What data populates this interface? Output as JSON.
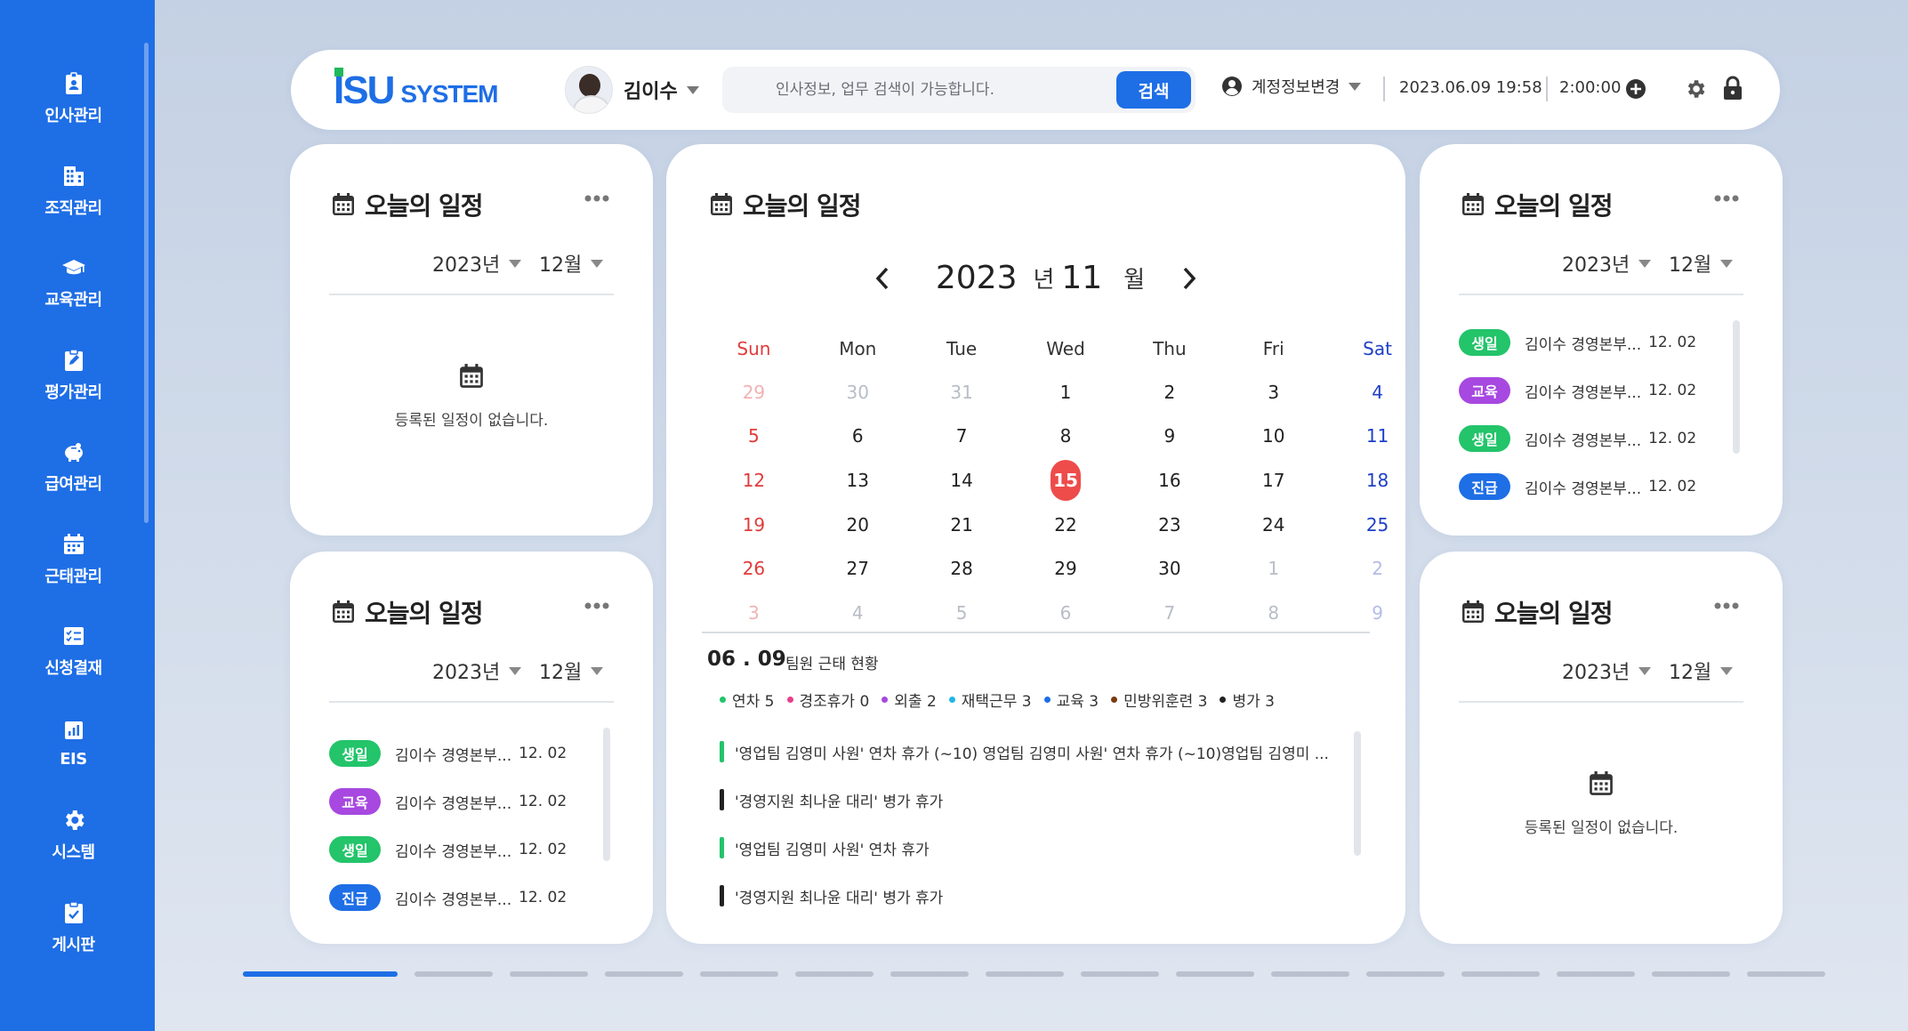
{
  "colors": {
    "primary": "#1e6ee6",
    "sunday": "#e23b3b",
    "saturday": "#1e3fc8",
    "today": "#ee4b4b"
  },
  "sidebar": {
    "items": [
      {
        "label": "인사관리",
        "icon": "id-badge-icon"
      },
      {
        "label": "조직관리",
        "icon": "building-icon"
      },
      {
        "label": "교육관리",
        "icon": "graduation-cap-icon"
      },
      {
        "label": "평가관리",
        "icon": "clipboard-edit-icon"
      },
      {
        "label": "급여관리",
        "icon": "piggy-bank-icon"
      },
      {
        "label": "근태관리",
        "icon": "calendar-icon"
      },
      {
        "label": "신청결재",
        "icon": "checklist-icon"
      },
      {
        "label": "EIS",
        "icon": "bar-chart-icon"
      },
      {
        "label": "시스템",
        "icon": "gear-icon"
      },
      {
        "label": "게시판",
        "icon": "clipboard-check-icon"
      }
    ]
  },
  "header": {
    "logo_mark": "ISU",
    "logo_text": "SYSTEM",
    "user_name": "김이수",
    "search_placeholder": "인사정보, 업무 검색이 가능합니다.",
    "search_button": "검색",
    "account_label": "계정정보변경",
    "datetime": "2023.06.09 19:58",
    "timer": "2:00:00"
  },
  "cards": {
    "tl": {
      "title": "오늘의 일정",
      "year": "2023년",
      "month": "12월",
      "empty": "등록된 일정이 없습니다."
    },
    "bl": {
      "title": "오늘의 일정",
      "year": "2023년",
      "month": "12월",
      "items": [
        {
          "badge": "생일",
          "color": "#23c46a",
          "text": "김이수 경영본부...",
          "date": "12. 02"
        },
        {
          "badge": "교육",
          "color": "#a748e0",
          "text": "김이수 경영본부...",
          "date": "12. 02"
        },
        {
          "badge": "생일",
          "color": "#23c46a",
          "text": "김이수 경영본부...",
          "date": "12. 02"
        },
        {
          "badge": "진급",
          "color": "#1e6ee6",
          "text": "김이수 경영본부...",
          "date": "12. 02"
        }
      ]
    },
    "tr": {
      "title": "오늘의 일정",
      "year": "2023년",
      "month": "12월",
      "items": [
        {
          "badge": "생일",
          "color": "#23c46a",
          "text": "김이수 경영본부...",
          "date": "12. 02"
        },
        {
          "badge": "교육",
          "color": "#a748e0",
          "text": "김이수 경영본부...",
          "date": "12. 02"
        },
        {
          "badge": "생일",
          "color": "#23c46a",
          "text": "김이수 경영본부...",
          "date": "12. 02"
        },
        {
          "badge": "진급",
          "color": "#1e6ee6",
          "text": "김이수 경영본부...",
          "date": "12. 02"
        }
      ]
    },
    "br": {
      "title": "오늘의 일정",
      "year": "2023년",
      "month": "12월",
      "empty": "등록된 일정이 없습니다."
    }
  },
  "calendar": {
    "title": "오늘의 일정",
    "year": "2023",
    "year_unit": "년",
    "month": "11",
    "month_unit": "월",
    "weekdays": [
      "Sun",
      "Mon",
      "Tue",
      "Wed",
      "Thu",
      "Fri",
      "Sat"
    ],
    "days": [
      {
        "d": "29",
        "o": true
      },
      {
        "d": "30",
        "o": true
      },
      {
        "d": "31",
        "o": true
      },
      {
        "d": "1"
      },
      {
        "d": "2"
      },
      {
        "d": "3"
      },
      {
        "d": "4"
      },
      {
        "d": "5"
      },
      {
        "d": "6"
      },
      {
        "d": "7"
      },
      {
        "d": "8"
      },
      {
        "d": "9"
      },
      {
        "d": "10"
      },
      {
        "d": "11"
      },
      {
        "d": "12"
      },
      {
        "d": "13"
      },
      {
        "d": "14"
      },
      {
        "d": "15",
        "today": true
      },
      {
        "d": "16"
      },
      {
        "d": "17"
      },
      {
        "d": "18"
      },
      {
        "d": "19"
      },
      {
        "d": "20"
      },
      {
        "d": "21"
      },
      {
        "d": "22"
      },
      {
        "d": "23"
      },
      {
        "d": "24"
      },
      {
        "d": "25"
      },
      {
        "d": "26"
      },
      {
        "d": "27"
      },
      {
        "d": "28"
      },
      {
        "d": "29"
      },
      {
        "d": "30"
      },
      {
        "d": "1",
        "o": true
      },
      {
        "d": "2",
        "o": true
      },
      {
        "d": "3",
        "o": true
      },
      {
        "d": "4",
        "o": true
      },
      {
        "d": "5",
        "o": true
      },
      {
        "d": "6",
        "o": true
      },
      {
        "d": "7",
        "o": true
      },
      {
        "d": "8",
        "o": true
      },
      {
        "d": "9",
        "o": true
      }
    ],
    "summary_date": "06 . 09",
    "summary_title": "팀원 근태 현황",
    "legend": [
      {
        "label": "연차 5",
        "color": "#23c46a"
      },
      {
        "label": "경조휴가 0",
        "color": "#e83e8c"
      },
      {
        "label": "외출 2",
        "color": "#a748e0"
      },
      {
        "label": "재택근무 3",
        "color": "#1fb6e6"
      },
      {
        "label": "교육 3",
        "color": "#1e6ee6"
      },
      {
        "label": "민방위훈련 3",
        "color": "#7a3b12"
      },
      {
        "label": "병가 3",
        "color": "#222222"
      }
    ],
    "entries": [
      {
        "text": "'영업팀 김영미 사원' 연차 휴가 (~10) 영업팀 김영미 사원' 연차 휴가 (~10)영업팀 김영미 ...",
        "color": "#23c46a"
      },
      {
        "text": "'경영지원 최나윤 대리' 병가 휴가",
        "color": "#222222"
      },
      {
        "text": "'영업팀 김영미 사원' 연차 휴가",
        "color": "#23c46a"
      },
      {
        "text": "'경영지원 최나윤 대리' 병가 휴가",
        "color": "#222222"
      }
    ]
  }
}
